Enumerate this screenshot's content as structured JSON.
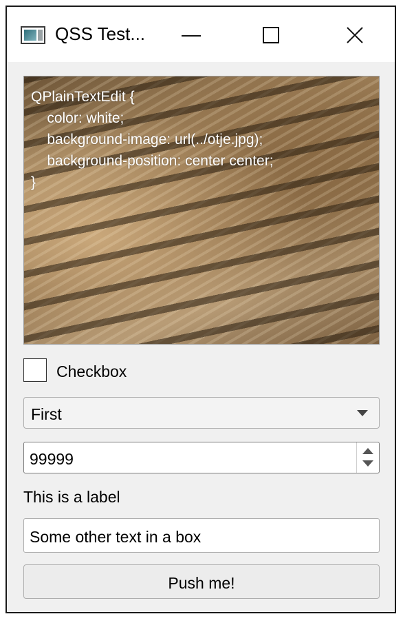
{
  "window": {
    "title": "QSS Test...",
    "icon": "app-window-icon"
  },
  "titlebar_buttons": {
    "minimize": "minimize-icon",
    "maximize": "maximize-icon",
    "close": "close-icon"
  },
  "editor": {
    "text": "QPlainTextEdit {\n    color: white;\n    background-image: url(../otje.jpg);\n    background-position: center center;\n}"
  },
  "checkbox": {
    "label": "Checkbox",
    "checked": false
  },
  "combo": {
    "selected": "First",
    "icon": "chevron-down-icon"
  },
  "spinbox": {
    "value": "99999"
  },
  "label": {
    "text": "This is a label"
  },
  "line_edit": {
    "value": "Some other text in a box"
  },
  "push_button": {
    "label": "Push me!"
  }
}
